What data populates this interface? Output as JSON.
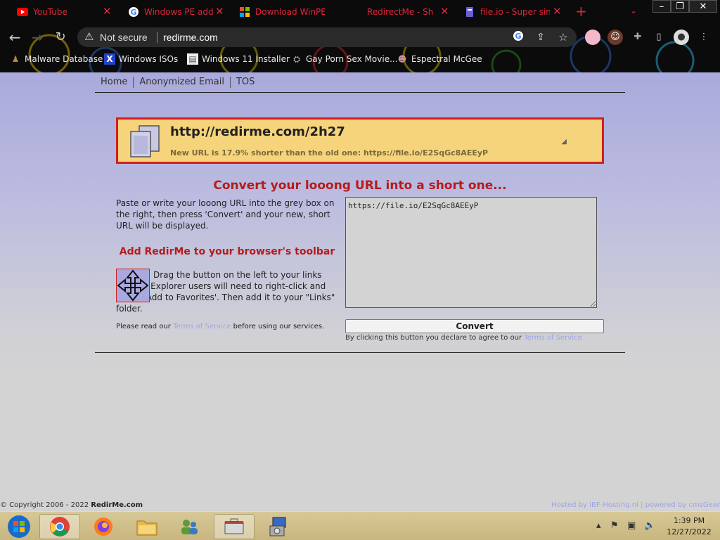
{
  "browser": {
    "tabs": [
      {
        "title": "YouTube",
        "icon": "youtube-icon"
      },
      {
        "title": "Windows PE add-",
        "icon": "google-icon"
      },
      {
        "title": "Download WinPE",
        "icon": "microsoft-icon"
      },
      {
        "title": "RedirectMe - Sh",
        "icon": "none"
      },
      {
        "title": "file.io - Super sim",
        "icon": "file-io-icon"
      }
    ],
    "address": {
      "security_label": "Not secure",
      "url": "redirme.com"
    },
    "bookmarks": [
      {
        "label": "Malware Database",
        "icon": "user-icon"
      },
      {
        "label": "Windows ISOs",
        "icon": "x-icon"
      },
      {
        "label": "Windows 11 Installer",
        "icon": "page-icon"
      },
      {
        "label": "Gay Porn Sex Movie...",
        "icon": "site-icon"
      },
      {
        "label": "Espectral McGee",
        "icon": "avatar-icon"
      }
    ]
  },
  "site": {
    "nav": [
      "Home",
      "Anonymized Email",
      "TOS"
    ],
    "result": {
      "short_url": "http://redirme.com/2h27",
      "info": "New URL is 17.9% shorter than the old one: https://file.io/E2SqGc8AEEyP"
    },
    "heading": "Convert your looong URL into a short one...",
    "intro": "Paste or write your looong URL into the grey box on the right, then press 'Convert' and your new, short URL will be displayed.",
    "toolbar_heading": "Add RedirMe to your browser's toolbar",
    "drag_text": "Drag the button on the left to your links toolbar. Explorer users will need to right-click and select 'Add to Favorites'. Then add it to your \"Links\" folder.",
    "terms_note_before": "Please read our ",
    "terms_link": "Terms of Service",
    "terms_note_after": " before using our services.",
    "input_value": "https://file.io/E2SqGc8AEEyP",
    "convert_label": "Convert",
    "agree_text": "By clicking this button you declare to agree to our ",
    "agree_link": "Terms of Service",
    "footer_copyright_prefix": "© Copyright 2006 - 2022 ",
    "footer_site": "RedirMe.com",
    "footer_hosted": "Hosted by IBF-Hosting.nl",
    "footer_sep": "|",
    "footer_powered": "powered by cmsGear"
  },
  "taskbar": {
    "apps": [
      "start-orb",
      "chrome",
      "firefox",
      "file-explorer",
      "users-app",
      "toolbox-app",
      "installer-app"
    ],
    "time": "1:39 PM",
    "date": "12/27/2022"
  },
  "colors": {
    "accent_red": "#d21e1e",
    "result_bg": "#f6d47c",
    "page_purple": "#a9a9dc",
    "link_blue": "#9da4e6",
    "tab_text": "#e0263a"
  }
}
